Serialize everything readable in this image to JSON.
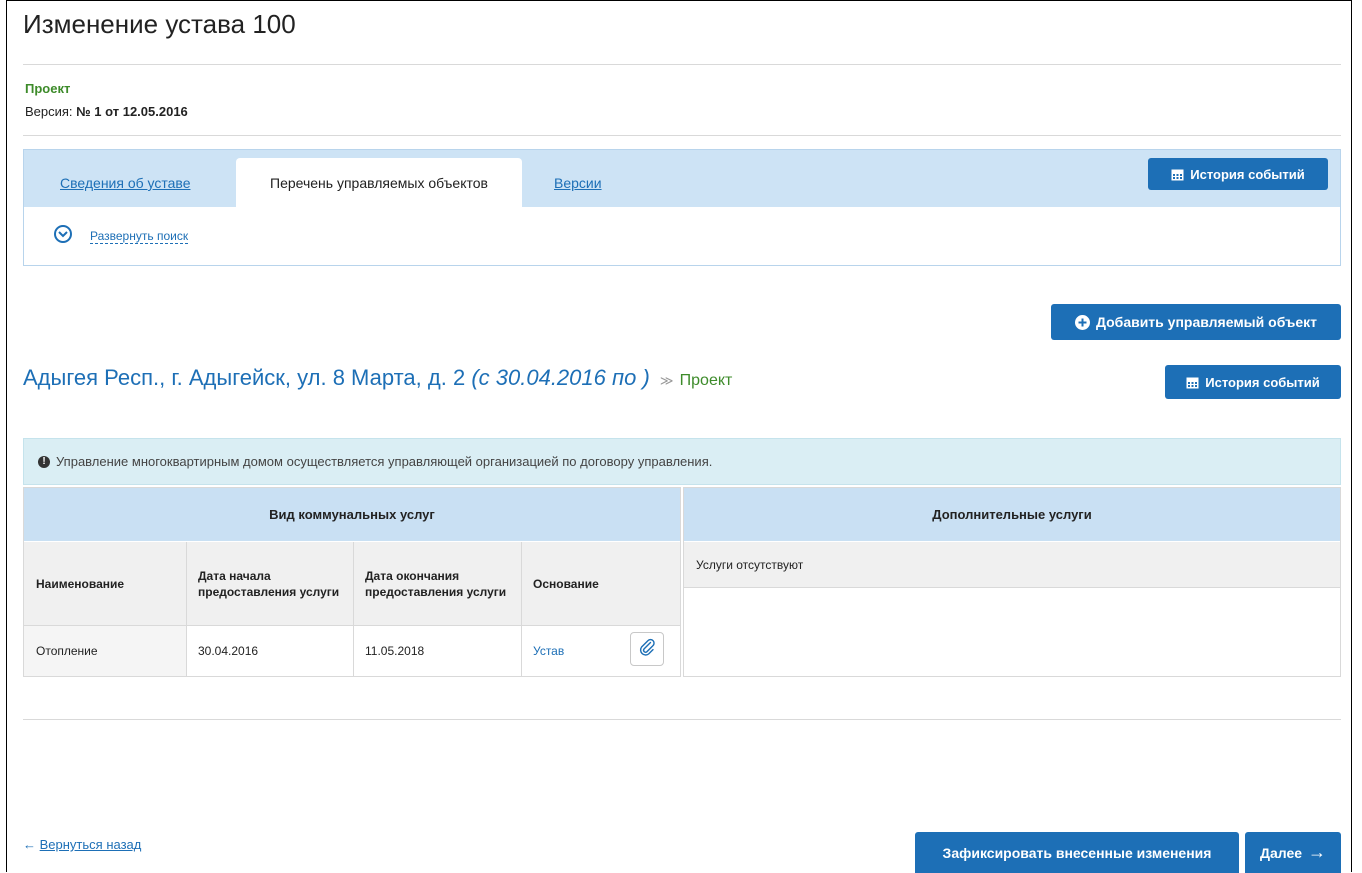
{
  "page": {
    "title": "Изменение устава 100",
    "status": "Проект",
    "version_label": "Версия:",
    "version_value": "№ 1 от 12.05.2016"
  },
  "tabs": {
    "items": [
      {
        "label": "Сведения об уставе",
        "active": false
      },
      {
        "label": "Перечень управляемых объектов",
        "active": true
      },
      {
        "label": "Версии",
        "active": false
      }
    ],
    "history_button": "История событий",
    "expand_search": "Развернуть поиск"
  },
  "actions": {
    "add_object": "Добавить управляемый объект"
  },
  "object": {
    "address": "Адыгея Респ., г. Адыгейск, ул. 8 Марта, д. 2",
    "period": "(с 30.04.2016 по )",
    "chevron": "≫",
    "status": "Проект",
    "history_button": "История событий",
    "info_icon": "!",
    "info": "Управление многоквартирным домом осуществляется управляющей организацией по договору управления."
  },
  "utility_services": {
    "header": "Вид коммунальных услуг",
    "columns": [
      "Наименование",
      "Дата начала предоставления услуги",
      "Дата окончания предоставления услуги",
      "Основание"
    ],
    "rows": [
      {
        "name": "Отопление",
        "start": "30.04.2016",
        "end": "11.05.2018",
        "basis": "Устав"
      }
    ]
  },
  "additional_services": {
    "header": "Дополнительные услуги",
    "empty_text": "Услуги отсутствуют"
  },
  "footer": {
    "back_arrow": "←",
    "back_link": "Вернуться назад",
    "commit_button": "Зафиксировать внесенные изменения",
    "next_button": "Далее",
    "next_arrow": "→"
  },
  "colors": {
    "accent": "#1d6fb6",
    "status_green": "#3d8b2a",
    "tab_bar": "#cde3f5",
    "info_bg": "#daeef4"
  }
}
